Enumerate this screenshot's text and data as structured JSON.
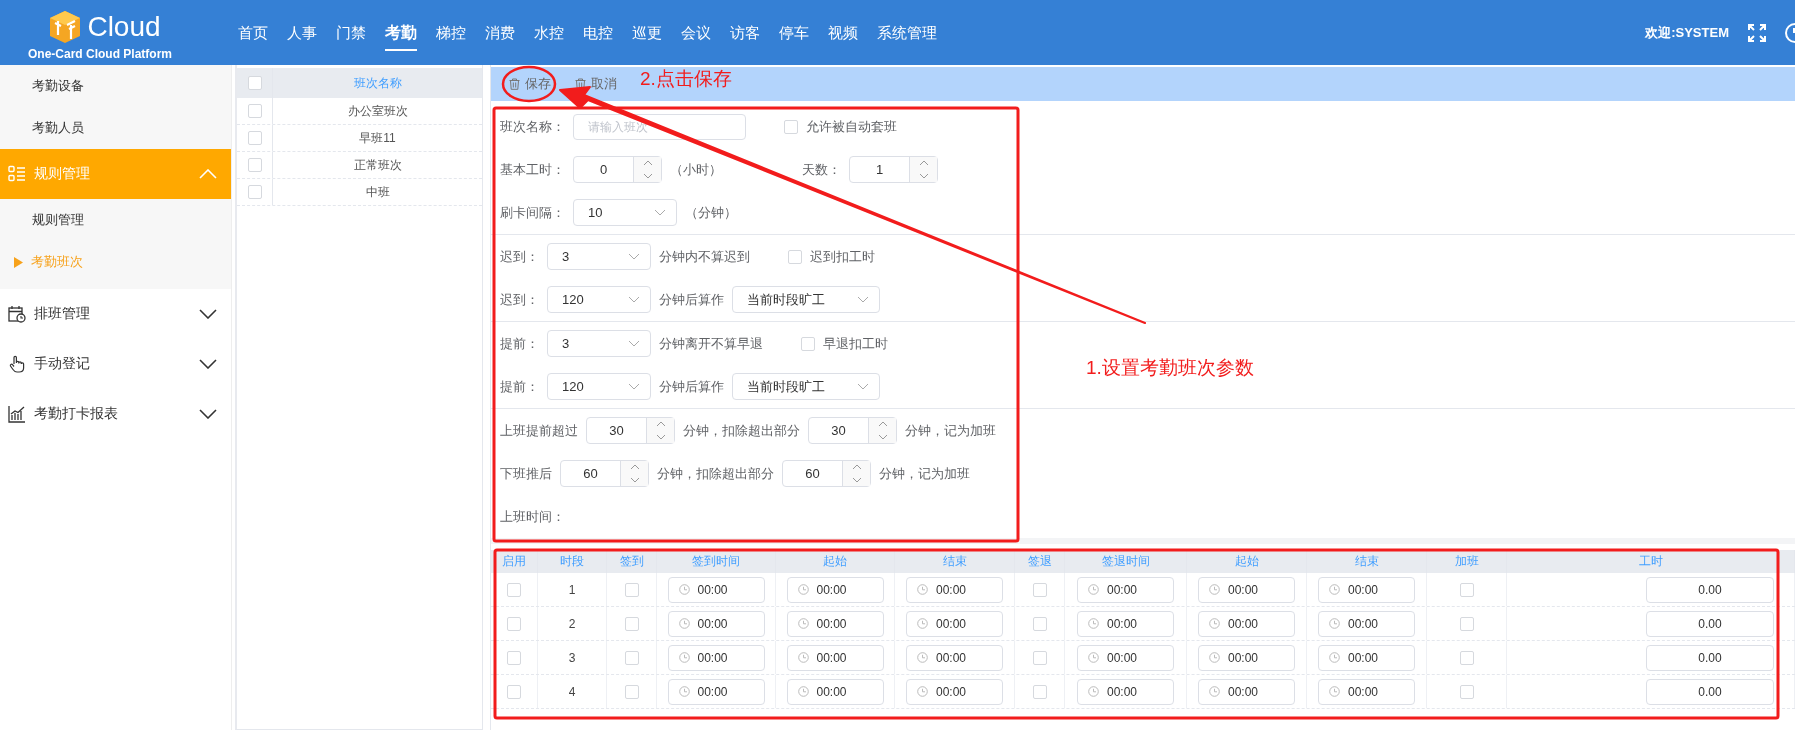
{
  "header": {
    "logo_text": "Cloud",
    "logo_subtitle": "One-Card Cloud Platform",
    "nav": [
      {
        "label": "首页",
        "selected": false
      },
      {
        "label": "人事",
        "selected": false
      },
      {
        "label": "门禁",
        "selected": false
      },
      {
        "label": "考勤",
        "selected": true
      },
      {
        "label": "梯控",
        "selected": false
      },
      {
        "label": "消费",
        "selected": false
      },
      {
        "label": "水控",
        "selected": false
      },
      {
        "label": "电控",
        "selected": false
      },
      {
        "label": "巡更",
        "selected": false
      },
      {
        "label": "会议",
        "selected": false
      },
      {
        "label": "访客",
        "selected": false
      },
      {
        "label": "停车",
        "selected": false
      },
      {
        "label": "视频",
        "selected": false
      },
      {
        "label": "系统管理",
        "selected": false
      }
    ],
    "welcome": "欢迎:SYSTEM"
  },
  "sidebar": {
    "items": [
      {
        "kind": "sub",
        "label": "考勤设备",
        "selected": false
      },
      {
        "kind": "sub",
        "label": "考勤人员",
        "selected": false
      },
      {
        "kind": "group",
        "label": "规则管理",
        "expanded": true,
        "children": [
          {
            "label": "规则管理",
            "selected": false
          },
          {
            "label": "考勤班次",
            "selected": true
          }
        ]
      },
      {
        "kind": "group",
        "label": "排班管理",
        "expanded": false
      },
      {
        "kind": "group",
        "label": "手动登记",
        "expanded": false
      },
      {
        "kind": "group",
        "label": "考勤打卡报表",
        "expanded": false
      }
    ]
  },
  "shift_list": {
    "header": {
      "label": "班次名称",
      "checked": false
    },
    "rows": [
      {
        "name": "办公室班次",
        "checked": false
      },
      {
        "name": "早班11",
        "checked": false
      },
      {
        "name": "正常班次",
        "checked": false
      },
      {
        "name": "中班",
        "checked": false
      }
    ]
  },
  "toolbar": {
    "buttons": [
      {
        "label": "保存"
      },
      {
        "label": "取消"
      }
    ]
  },
  "form": {
    "groups": [
      {
        "rows": [
          {
            "items": [
              {
                "kind": "label",
                "text": "班次名称："
              },
              {
                "kind": "input",
                "placeholder": "请输入班次"
              },
              {
                "kind": "checkbox",
                "label": "允许被自动套班",
                "checked": false
              }
            ]
          },
          {
            "items": [
              {
                "kind": "label",
                "text": "基本工时："
              },
              {
                "kind": "spinner",
                "value": "0"
              },
              {
                "kind": "text",
                "text": "（小时）"
              },
              {
                "kind": "covered_label",
                "text": "天数："
              },
              {
                "kind": "spinner",
                "value": "1"
              }
            ]
          },
          {
            "items": [
              {
                "kind": "label",
                "text": "刷卡间隔："
              },
              {
                "kind": "select",
                "value": "10"
              },
              {
                "kind": "text",
                "text": "（分钟）"
              }
            ]
          }
        ]
      },
      {
        "rows": [
          {
            "items": [
              {
                "kind": "label",
                "text": "迟到："
              },
              {
                "kind": "select",
                "value": "3"
              },
              {
                "kind": "text",
                "text": "分钟内不算迟到"
              },
              {
                "kind": "checkbox",
                "label": "迟到扣工时",
                "checked": false
              }
            ]
          },
          {
            "items": [
              {
                "kind": "label",
                "text": "迟到："
              },
              {
                "kind": "select",
                "value": "120"
              },
              {
                "kind": "text",
                "text": "分钟后算作"
              },
              {
                "kind": "wide_select",
                "value": "当前时段旷工"
              }
            ]
          }
        ]
      },
      {
        "rows": [
          {
            "items": [
              {
                "kind": "label",
                "text": "提前："
              },
              {
                "kind": "select",
                "value": "3"
              },
              {
                "kind": "text",
                "text": "分钟离开不算早退"
              },
              {
                "kind": "checkbox",
                "label": "早退扣工时",
                "checked": false
              }
            ]
          },
          {
            "items": [
              {
                "kind": "label",
                "text": "提前："
              },
              {
                "kind": "select",
                "value": "120"
              },
              {
                "kind": "text",
                "text": "分钟后算作"
              },
              {
                "kind": "wide_select",
                "value": "当前时段旷工"
              }
            ]
          }
        ]
      },
      {
        "rows": [
          {
            "items": [
              {
                "kind": "label",
                "text": "上班提前超过"
              },
              {
                "kind": "spinner",
                "value": "30"
              },
              {
                "kind": "text",
                "text": "分钟，扣除超出部分"
              },
              {
                "kind": "spinner",
                "value": "30"
              },
              {
                "kind": "text",
                "text": "分钟，记为加班"
              }
            ]
          },
          {
            "items": [
              {
                "kind": "label",
                "text": "下班推后"
              },
              {
                "kind": "spinner",
                "value": "60"
              },
              {
                "kind": "text",
                "text": "分钟，扣除超出部分"
              },
              {
                "kind": "spinner",
                "value": "60"
              },
              {
                "kind": "text",
                "text": "分钟，记为加班"
              }
            ]
          },
          {
            "items": [
              {
                "kind": "label",
                "text": "上班时间："
              }
            ]
          }
        ]
      }
    ]
  },
  "periods": {
    "columns": [
      "启用",
      "时段",
      "签到",
      "签到时间",
      "起始",
      "结束",
      "签退",
      "签退时间",
      "起始",
      "结束",
      "加班",
      "工时"
    ],
    "rows": [
      {
        "enabled": false,
        "period": "1",
        "sign_in": false,
        "sign_in_time": "00:00",
        "sign_in_start": "00:00",
        "sign_in_end": "00:00",
        "sign_out": false,
        "sign_out_time": "00:00",
        "sign_out_start": "00:00",
        "sign_out_end": "00:00",
        "overtime": false,
        "hours": "0.00"
      },
      {
        "enabled": false,
        "period": "2",
        "sign_in": false,
        "sign_in_time": "00:00",
        "sign_in_start": "00:00",
        "sign_in_end": "00:00",
        "sign_out": false,
        "sign_out_time": "00:00",
        "sign_out_start": "00:00",
        "sign_out_end": "00:00",
        "overtime": false,
        "hours": "0.00"
      },
      {
        "enabled": false,
        "period": "3",
        "sign_in": false,
        "sign_in_time": "00:00",
        "sign_in_start": "00:00",
        "sign_in_end": "00:00",
        "sign_out": false,
        "sign_out_time": "00:00",
        "sign_out_start": "00:00",
        "sign_out_end": "00:00",
        "overtime": false,
        "hours": "0.00"
      },
      {
        "enabled": false,
        "period": "4",
        "sign_in": false,
        "sign_in_time": "00:00",
        "sign_in_start": "00:00",
        "sign_in_end": "00:00",
        "sign_out": false,
        "sign_out_time": "00:00",
        "sign_out_start": "00:00",
        "sign_out_end": "00:00",
        "overtime": false,
        "hours": "0.00"
      }
    ]
  },
  "annotations": [
    {
      "kind": "callout",
      "text": "2.点击保存"
    },
    {
      "kind": "callout",
      "text": "1.设置考勤班次参数"
    }
  ]
}
